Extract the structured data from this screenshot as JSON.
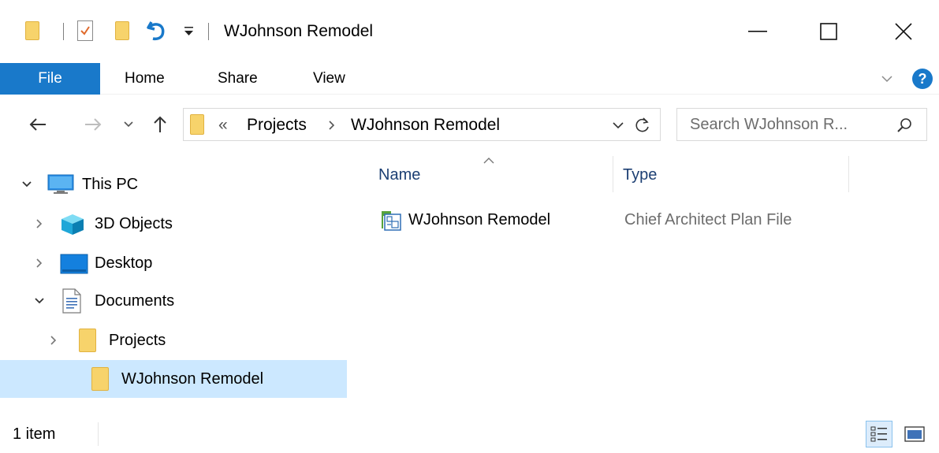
{
  "window": {
    "title": "WJohnson Remodel",
    "minimize_glyph": "—",
    "maximize_glyph": "☐",
    "close_glyph": "✕"
  },
  "ribbon": {
    "tabs": [
      {
        "label": "File"
      },
      {
        "label": "Home"
      },
      {
        "label": "Share"
      },
      {
        "label": "View"
      }
    ],
    "help_glyph": "?"
  },
  "address": {
    "overflow_glyph": "«",
    "breadcrumbs": [
      "Projects",
      "WJohnson Remodel"
    ],
    "search_placeholder": "Search WJohnson R..."
  },
  "navigation": {
    "items": [
      {
        "label": "This PC",
        "level": 0,
        "expanded": true,
        "icon": "monitor-icon"
      },
      {
        "label": "3D Objects",
        "level": 1,
        "expanded": false,
        "icon": "cube-icon"
      },
      {
        "label": "Desktop",
        "level": 1,
        "expanded": false,
        "icon": "desktop-icon"
      },
      {
        "label": "Documents",
        "level": 1,
        "expanded": true,
        "icon": "document-icon"
      },
      {
        "label": "Projects",
        "level": 2,
        "expanded": false,
        "icon": "folder-icon"
      },
      {
        "label": "WJohnson Remodel",
        "level": 3,
        "selected": true,
        "icon": "folder-icon"
      }
    ]
  },
  "file_list": {
    "columns": [
      {
        "label": "Name"
      },
      {
        "label": "Type"
      }
    ],
    "rows": [
      {
        "name": "WJohnson Remodel",
        "type": "Chief Architect Plan File",
        "icon": "plan-file-icon"
      }
    ]
  },
  "status": {
    "item_count": "1 item"
  },
  "colors": {
    "accent": "#1979ca",
    "selection": "#cce8ff",
    "folder": "#f7d36b",
    "header_text": "#1c3f73",
    "secondary_text": "#6d6d6d",
    "help": "#1979ca"
  }
}
